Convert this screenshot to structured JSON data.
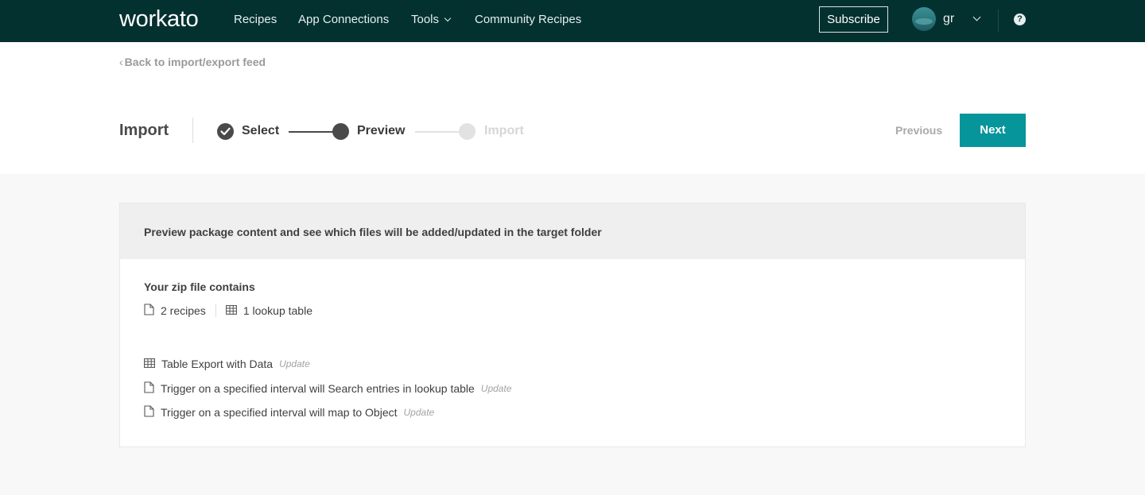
{
  "nav": {
    "logo": "workato",
    "links": [
      "Recipes",
      "App Connections",
      "Tools",
      "Community Recipes"
    ],
    "subscribe": "Subscribe",
    "username": "gr",
    "help": "?"
  },
  "back_link": "Back to import/export feed",
  "wizard": {
    "title": "Import",
    "steps": [
      {
        "label": "Select",
        "state": "done"
      },
      {
        "label": "Preview",
        "state": "active"
      },
      {
        "label": "Import",
        "state": "inactive"
      }
    ],
    "previous": "Previous",
    "next": "Next"
  },
  "card": {
    "header": "Preview package content and see which files will be added/updated in the target folder",
    "zip_title": "Your zip file contains",
    "summary": {
      "recipes": "2 recipes",
      "tables": "1 lookup table"
    },
    "items": [
      {
        "icon": "table-icon",
        "name": "Table Export with Data",
        "status": "Update"
      },
      {
        "icon": "file-icon",
        "name": "Trigger on a specified interval will Search entries in lookup table",
        "status": "Update"
      },
      {
        "icon": "file-icon",
        "name": "Trigger on a specified interval will map to Object",
        "status": "Update"
      }
    ]
  },
  "colors": {
    "nav_bg": "#02312f",
    "accent": "#06959a",
    "step_active": "#4a4a4a",
    "step_inactive": "#e2e2e2"
  }
}
